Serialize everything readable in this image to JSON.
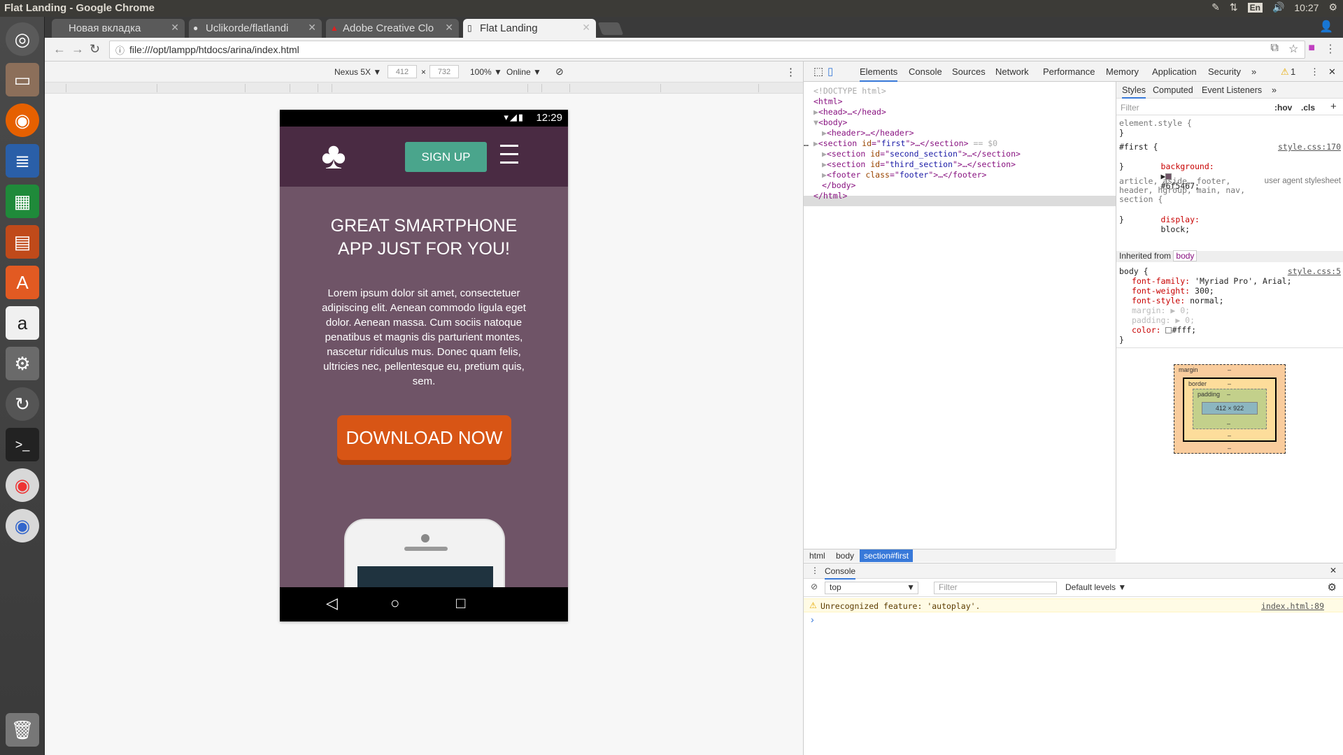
{
  "system": {
    "window_title": "Flat Landing - Google Chrome",
    "clock": "10:27",
    "keyboard_layout": "En"
  },
  "tabs": [
    {
      "label": "Новая вкладка"
    },
    {
      "label": "Uclikorde/flatlandi"
    },
    {
      "label": "Adobe Creative Clo"
    },
    {
      "label": "Flat Landing"
    }
  ],
  "address_bar": {
    "url": "file:///opt/lampp/htdocs/arina/index.html"
  },
  "device_toolbar": {
    "device": "Nexus 5X ▼",
    "width": "412",
    "times": "×",
    "height": "732",
    "zoom": "100% ▼",
    "network": "Online ▼"
  },
  "phone": {
    "time": "12:29",
    "signup_label": "SIGN UP",
    "hero_title_line1": "GREAT SMARTPHONE",
    "hero_title_line2": "APP JUST FOR YOU!",
    "hero_text": "Lorem ipsum dolor sit amet, consectetuer adipiscing elit. Aenean commodo ligula eget dolor. Aenean massa. Cum sociis natoque penatibus et magnis dis parturient montes, nascetur ridiculus mus. Donec quam felis, ultricies nec, pellentesque eu, pretium quis, sem.",
    "download_label": "DOWNLOAD NOW",
    "background_color": "#6f5467",
    "header_color": "#4a2b43",
    "signup_color": "#4aa58c",
    "download_color": "#d85515"
  },
  "devtools": {
    "tabs": [
      "Elements",
      "Console",
      "Sources",
      "Network",
      "Performance",
      "Memory",
      "Application",
      "Security",
      "»"
    ],
    "warning_count": "1",
    "elements": {
      "doctype": "<!DOCTYPE html>",
      "html_open": "<html>",
      "head": "<head>…</head>",
      "body_open": "<body>",
      "header": "<header>…</header>",
      "section_first_tag": "section",
      "section_first_id": "first",
      "section_first_suffix": "== $0",
      "section_second_id": "second_section",
      "section_third_id": "third_section",
      "footer_class": "footer",
      "body_close": "</body>",
      "html_close": "</html>"
    },
    "breadcrumbs": [
      "html",
      "body",
      "section#first"
    ],
    "styles_tabs": [
      "Styles",
      "Computed",
      "Event Listeners",
      "»"
    ],
    "filter_placeholder": "Filter",
    "hov": ":hov",
    "cls": ".cls",
    "rules": {
      "element_style": "element.style {",
      "first_selector": "#first {",
      "first_source": "style.css:170",
      "first_prop": "background:",
      "first_value": "#6f5467;",
      "first_swatch": "#6f5467",
      "ua_selectors": "article, aside, footer,\nheader, hgroup, main, nav,\nsection {",
      "ua_source": "user agent stylesheet",
      "ua_prop": "display:",
      "ua_value": "block;",
      "inherited_label": "Inherited from",
      "inherited_tag": "body",
      "body_selector": "body {",
      "body_source": "style.css:5",
      "body_props": [
        {
          "name": "font-family:",
          "value": "'Myriad Pro', Arial;"
        },
        {
          "name": "font-weight:",
          "value": "300;"
        },
        {
          "name": "font-style:",
          "value": "normal;"
        },
        {
          "name": "margin:",
          "value": "▶ 0;"
        },
        {
          "name": "padding:",
          "value": "▶ 0;"
        },
        {
          "name": "color:",
          "value": "#fff;"
        }
      ]
    },
    "box_model": {
      "margin_label": "margin",
      "border_label": "border",
      "padding_label": "padding",
      "content": "412 × 922",
      "dash": "–"
    },
    "console": {
      "title": "Console",
      "context": "top",
      "filter_placeholder": "Filter",
      "levels": "Default levels ▼",
      "warning": "Unrecognized feature: 'autoplay'.",
      "warning_source": "index.html:89",
      "prompt": "›"
    }
  }
}
